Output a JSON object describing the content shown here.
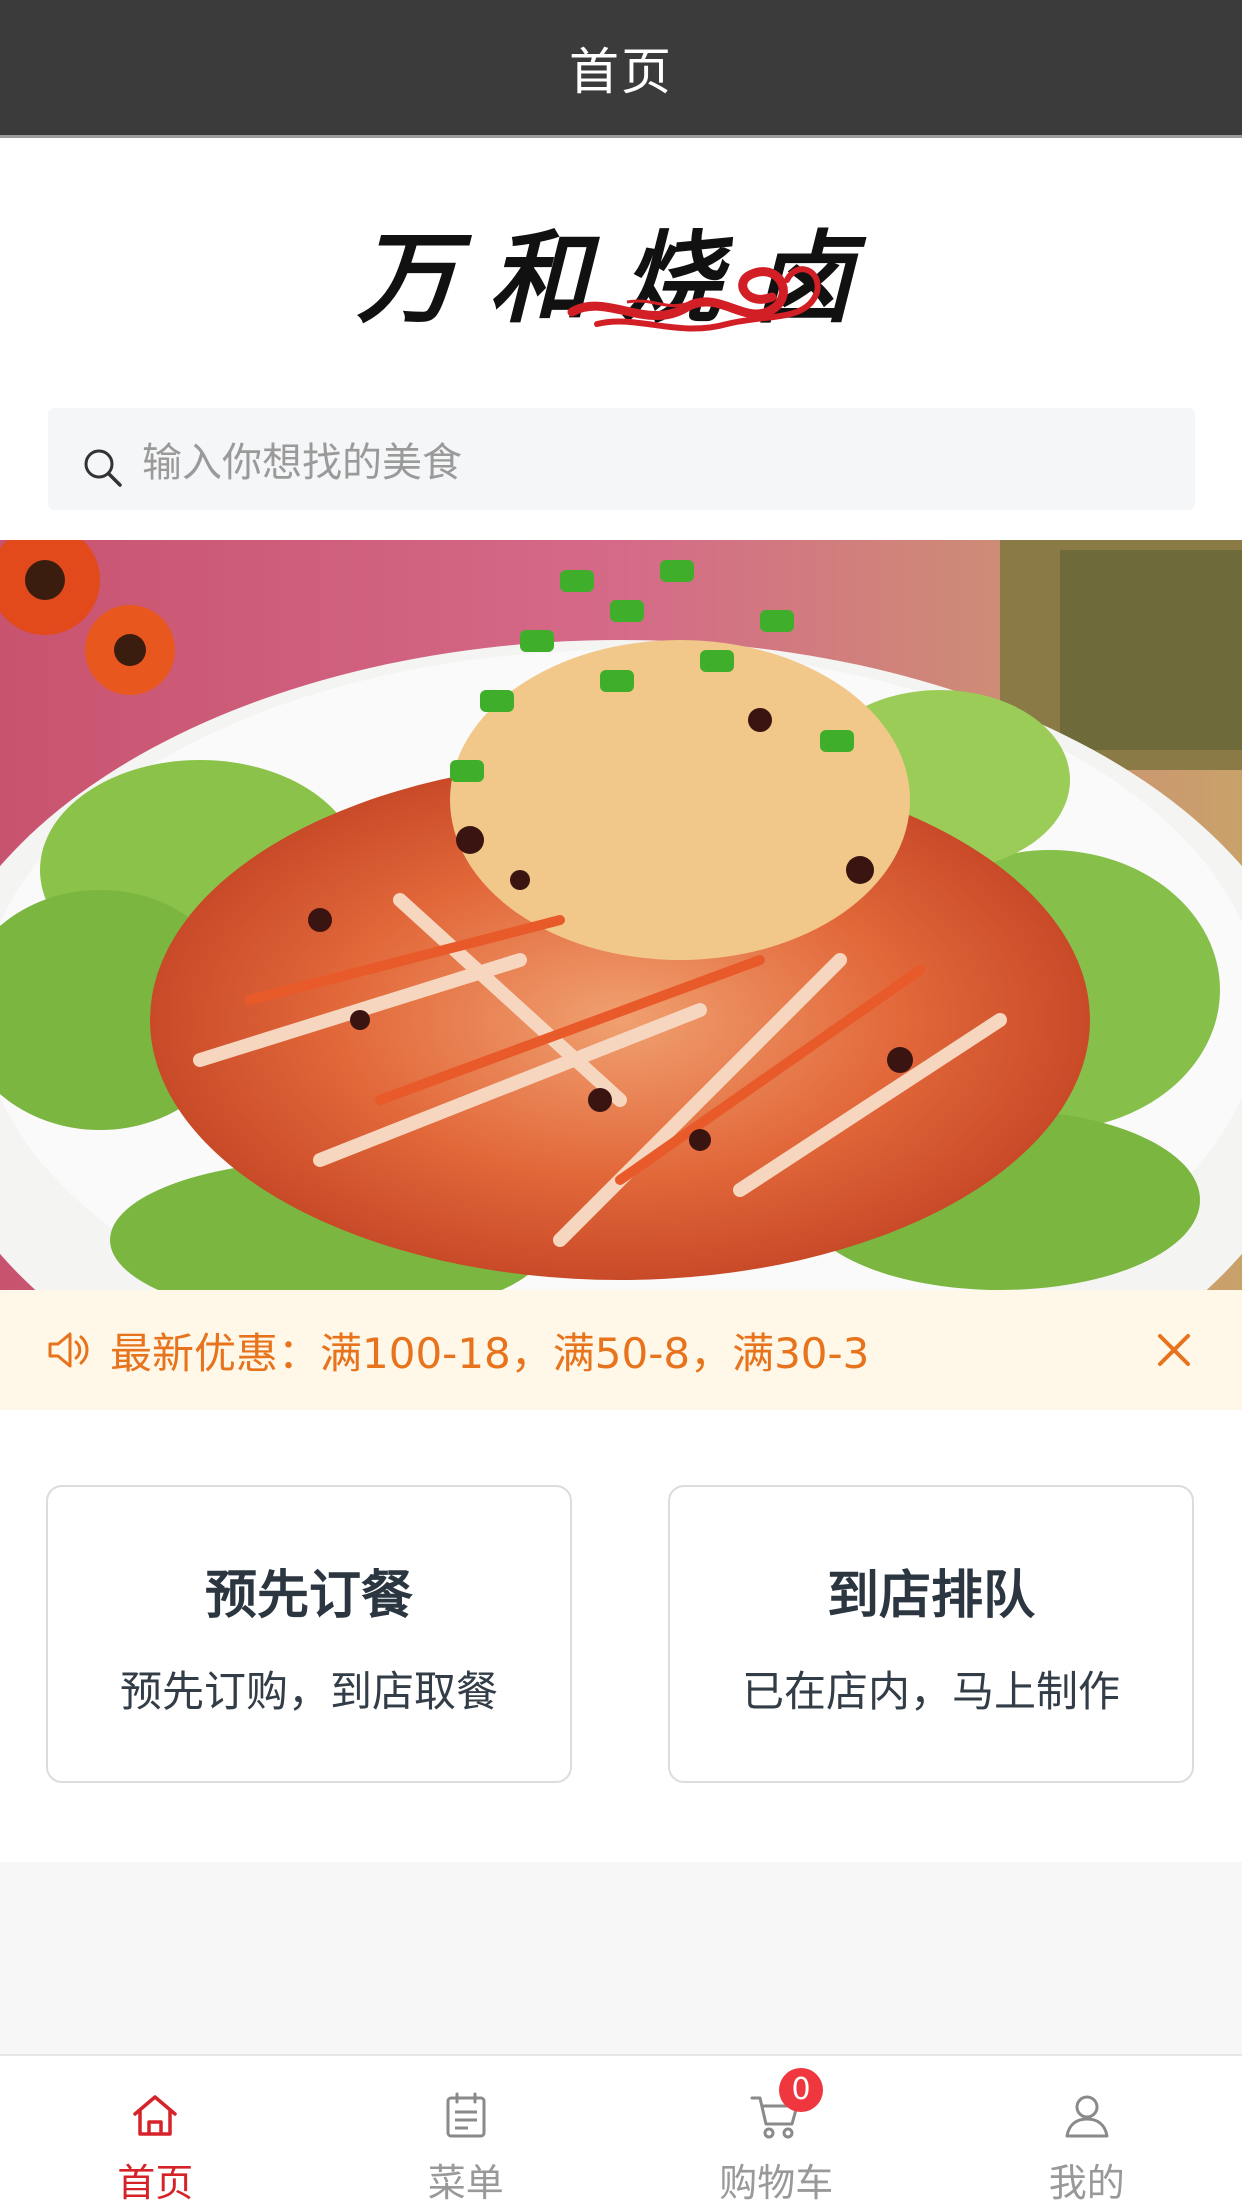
{
  "navbar": {
    "title": "首页",
    "background": "#3b3b3b"
  },
  "logo": {
    "text": "万和烧卤",
    "swirl_color": "#d21f26"
  },
  "search": {
    "placeholder": "输入你想找的美食"
  },
  "banner": {
    "alt": "手撕鸡"
  },
  "notice": {
    "text": "最新优惠：满100-18，满50-8，满30-3",
    "color": "#e7741d",
    "icon": "speaker-icon"
  },
  "cards": [
    {
      "title": "预先订餐",
      "subtitle": "预先订购，到店取餐"
    },
    {
      "title": "到店排队",
      "subtitle": "已在店内，马上制作"
    }
  ],
  "tabbar": {
    "active_color": "#d6232a",
    "items": [
      {
        "label": "首页",
        "icon": "home-icon",
        "active": true
      },
      {
        "label": "菜单",
        "icon": "menu-icon",
        "active": false
      },
      {
        "label": "购物车",
        "icon": "cart-icon",
        "active": false,
        "badge": "0"
      },
      {
        "label": "我的",
        "icon": "user-icon",
        "active": false
      }
    ]
  }
}
